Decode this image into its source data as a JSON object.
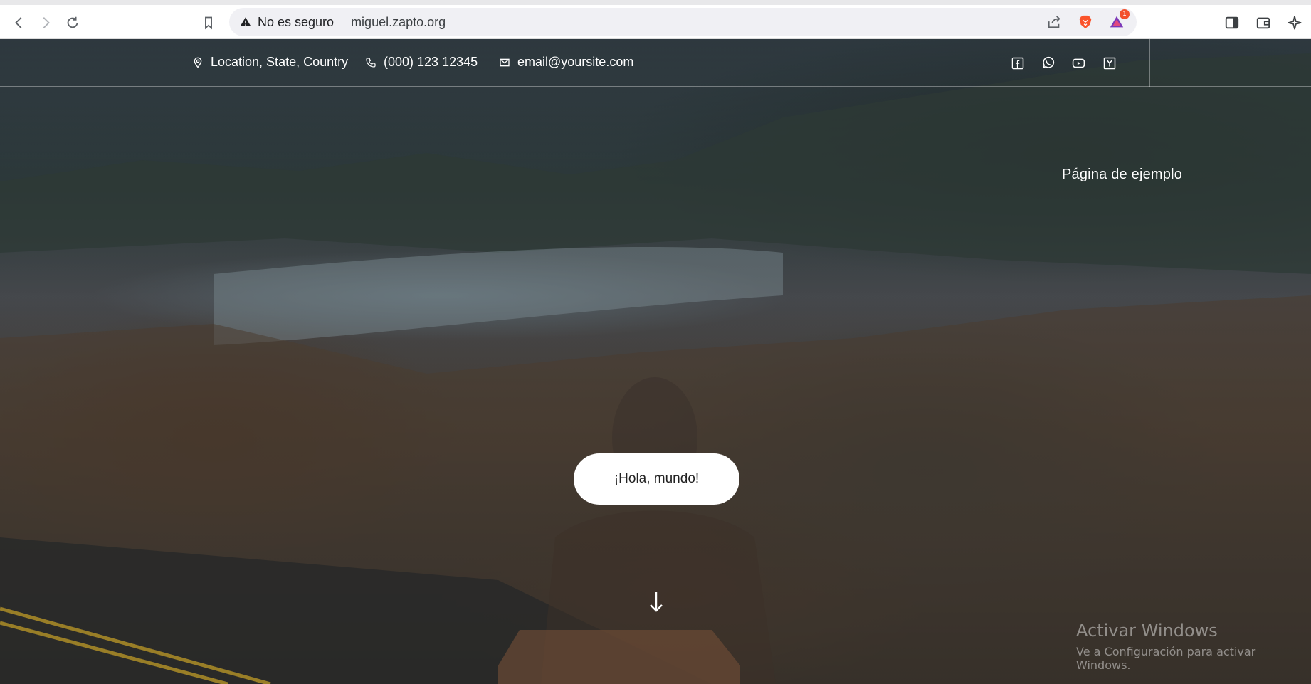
{
  "browser": {
    "security_label": "No es seguro",
    "url": "miguel.zapto.org",
    "rewards_badge": "1"
  },
  "topbar": {
    "location": "Location, State, Country",
    "phone": "(000) 123 12345",
    "email": "email@yoursite.com",
    "socials": [
      "facebook-icon",
      "whatsapp-icon",
      "youtube-icon",
      "yelp-icon"
    ]
  },
  "menu": {
    "items": [
      "Página de ejemplo"
    ]
  },
  "hero": {
    "button_label": "¡Hola, mundo!"
  },
  "watermark": {
    "title": "Activar Windows",
    "subtitle": "Ve a Configuración para activar Windows."
  },
  "colors": {
    "brave_orange": "#fb542b",
    "button_bg": "#ffffff"
  }
}
